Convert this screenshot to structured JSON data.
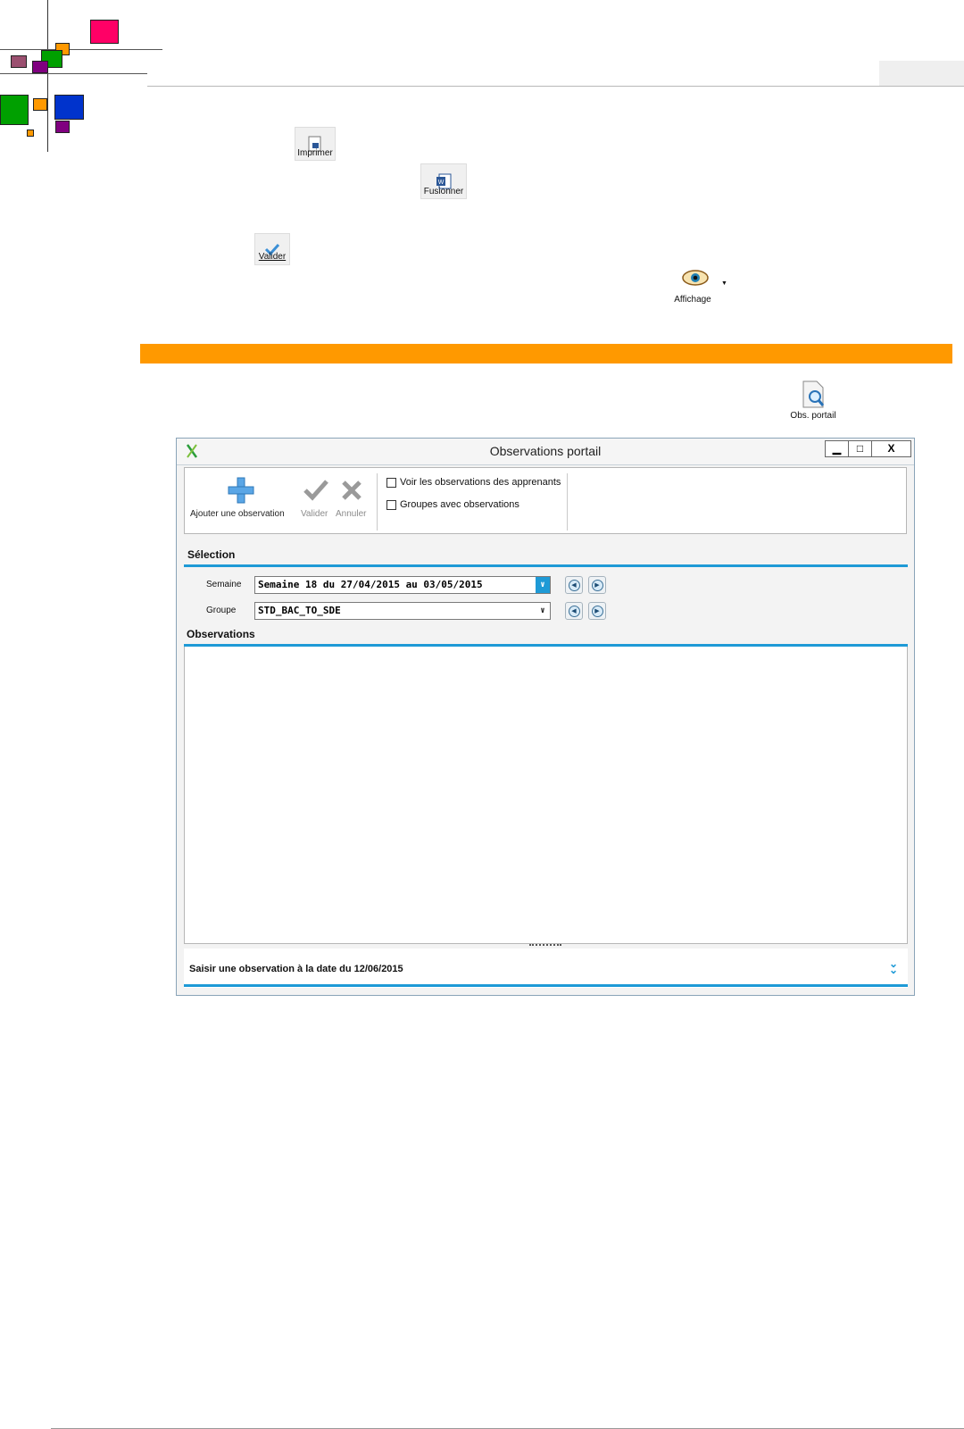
{
  "toolbar_buttons": {
    "imprimer": "Imprimer",
    "fusionner": "Fusionner",
    "valider": "Valider",
    "affichage": "Affichage",
    "obs_portail": "Obs. portail"
  },
  "colors": {
    "orange_bar": "#ff9900",
    "accent_blue": "#1e9ad6",
    "pink": "#ff0066",
    "green": "#00a000",
    "blue": "#0033cc",
    "purple": "#800080",
    "mauve": "#9b5070",
    "orange": "#ff9900"
  },
  "window": {
    "title": "Observations portail",
    "minimize": "▁",
    "maximize": "□",
    "close": "X",
    "toolbar": {
      "add_label": "Ajouter une observation",
      "validate_label": "Valider",
      "cancel_label": "Annuler",
      "check_apprenants": "Voir les observations des apprenants",
      "check_groupes": "Groupes avec observations"
    },
    "selection_title": "Sélection",
    "semaine_label": "Semaine",
    "semaine_value": "Semaine 18 du 27/04/2015 au 03/05/2015",
    "groupe_label": "Groupe",
    "groupe_value": "STD_BAC_TO_SDE",
    "observations_title": "Observations",
    "footer_title": "Saisir une observation à la date du 12/06/2015"
  }
}
